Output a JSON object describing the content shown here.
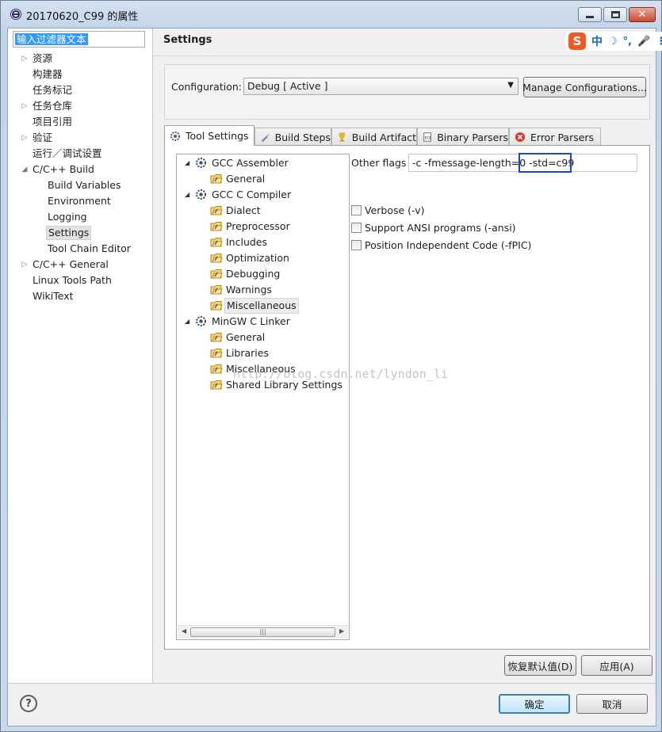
{
  "window": {
    "title": "20170620_C99 的属性"
  },
  "filter": {
    "placeholder": "输入过滤器文本"
  },
  "nav": [
    {
      "label": "资源",
      "expandable": true
    },
    {
      "label": "构建器",
      "expandable": false
    },
    {
      "label": "任务标记",
      "expandable": false
    },
    {
      "label": "任务仓库",
      "expandable": true
    },
    {
      "label": "项目引用",
      "expandable": false
    },
    {
      "label": "验证",
      "expandable": true
    },
    {
      "label": "运行／调试设置",
      "expandable": false
    },
    {
      "label": "C/C++ Build",
      "expanded": true
    },
    {
      "label": "Build Variables",
      "child": true
    },
    {
      "label": "Environment",
      "child": true
    },
    {
      "label": "Logging",
      "child": true
    },
    {
      "label": "Settings",
      "child": true,
      "selected": true
    },
    {
      "label": "Tool Chain Editor",
      "child": true
    },
    {
      "label": "C/C++ General",
      "expandable": true
    },
    {
      "label": "Linux Tools Path",
      "expandable": false
    },
    {
      "label": "WikiText",
      "expandable": false
    }
  ],
  "header": {
    "title": "Settings",
    "ime": {
      "logo": "S",
      "mode": "中",
      "moon": "☽",
      "punct": "°,",
      "mic": "🎤",
      "more": "⋮"
    }
  },
  "configuration": {
    "label": "Configuration:",
    "value": "Debug  [ Active ]",
    "manage_label": "Manage Configurations..."
  },
  "tabs": [
    {
      "label": "Tool Settings",
      "icon": "gear-icon",
      "active": true
    },
    {
      "label": "Build Steps",
      "icon": "brush-icon"
    },
    {
      "label": "Build Artifact",
      "icon": "trophy-icon"
    },
    {
      "label": "Binary Parsers",
      "icon": "binary-icon"
    },
    {
      "label": "Error Parsers",
      "icon": "error-icon"
    }
  ],
  "tool_tree": [
    {
      "label": "GCC Assembler",
      "type": "tool"
    },
    {
      "label": "General",
      "type": "category"
    },
    {
      "label": "GCC C Compiler",
      "type": "tool"
    },
    {
      "label": "Dialect",
      "type": "category"
    },
    {
      "label": "Preprocessor",
      "type": "category"
    },
    {
      "label": "Includes",
      "type": "category"
    },
    {
      "label": "Optimization",
      "type": "category"
    },
    {
      "label": "Debugging",
      "type": "category"
    },
    {
      "label": "Warnings",
      "type": "category"
    },
    {
      "label": "Miscellaneous",
      "type": "category",
      "selected": true
    },
    {
      "label": "MinGW C Linker",
      "type": "tool"
    },
    {
      "label": "General",
      "type": "category"
    },
    {
      "label": "Libraries",
      "type": "category"
    },
    {
      "label": "Miscellaneous",
      "type": "category"
    },
    {
      "label": "Shared Library Settings",
      "type": "category"
    }
  ],
  "options": {
    "other_flags_label": "Other flags",
    "other_flags_value": "-c -fmessage-length=0 -std=c99",
    "checkboxes": [
      {
        "label": "Verbose (-v)",
        "checked": false
      },
      {
        "label": "Support ANSI programs (-ansi)",
        "checked": false
      },
      {
        "label": "Position Independent Code (-fPIC)",
        "checked": false
      }
    ]
  },
  "watermark": "http://blog.csdn.net/lyndon_li",
  "footer": {
    "restore_label": "恢复默认值(D)",
    "apply_label": "应用(A)",
    "ok_label": "确定",
    "cancel_label": "取消",
    "help_glyph": "?"
  },
  "colors": {
    "highlight": "#1f46c8",
    "selection": "#3399ff",
    "ime_brand": "#ee5a1f"
  }
}
